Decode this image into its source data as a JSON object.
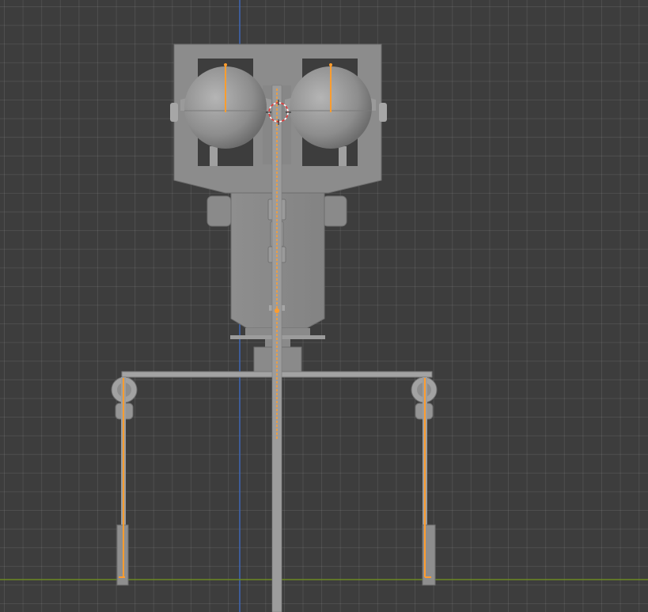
{
  "app": "3D viewport",
  "view": {
    "background": "#3d3d3d",
    "grid_color": "#555555",
    "axis_y_color": "#3f67b5",
    "axis_x_color": "#6d8a23"
  },
  "model": {
    "mesh_color": "#8a8a8a",
    "mesh_shade": "#7a7a7a",
    "mesh_highlight": "#a4a4a4",
    "bone_color": "#ff9d2e",
    "cursor_icon": "3d-cursor-icon"
  }
}
